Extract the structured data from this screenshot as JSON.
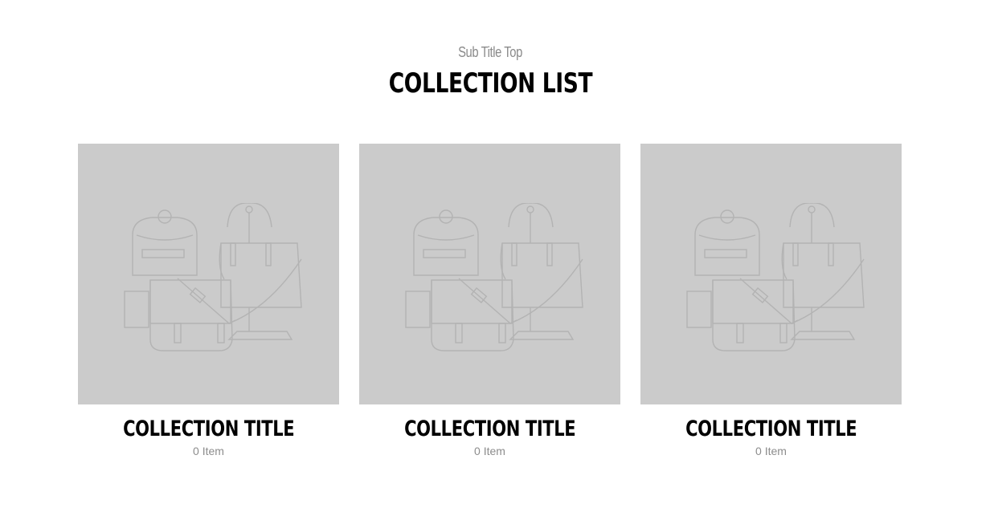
{
  "section": {
    "subtitle": "Sub Title Top",
    "title": "COLLECTION LIST"
  },
  "collections": [
    {
      "title": "COLLECTION TITLE",
      "count": "0 Item",
      "image_icon": "bags-placeholder-icon"
    },
    {
      "title": "COLLECTION TITLE",
      "count": "0 Item",
      "image_icon": "bags-placeholder-icon"
    },
    {
      "title": "COLLECTION TITLE",
      "count": "0 Item",
      "image_icon": "bags-placeholder-icon"
    }
  ],
  "colors": {
    "placeholder_bg": "#cbcbcb",
    "placeholder_line": "#b3b3b3",
    "title_text": "#000000",
    "muted_text": "#8c8c8c"
  }
}
